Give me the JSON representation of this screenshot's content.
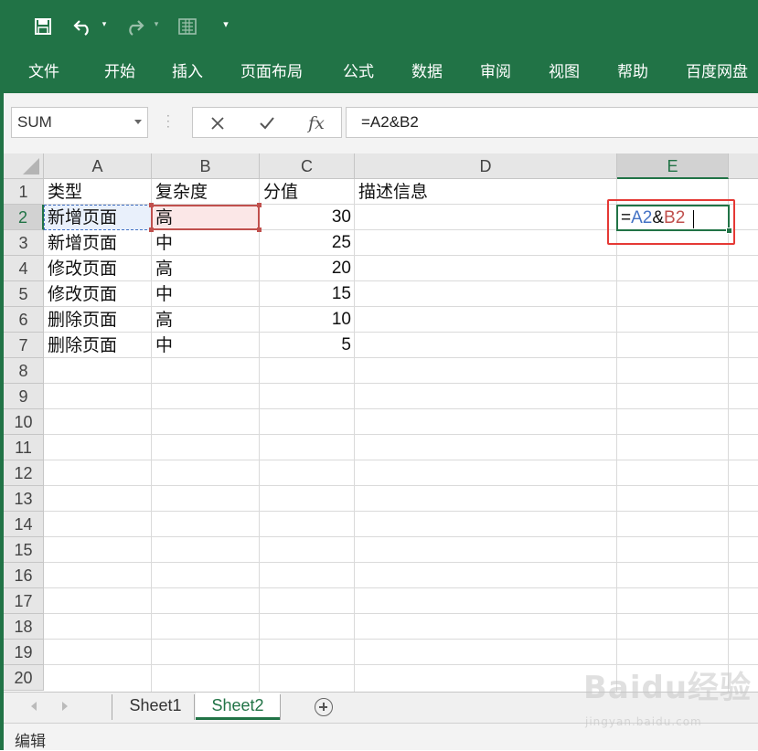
{
  "quick_access": {
    "icons": [
      "save-icon",
      "undo-icon",
      "redo-icon",
      "touch-mode-icon",
      "customize-toolbar-icon"
    ]
  },
  "ribbon": {
    "tabs": [
      "文件",
      "开始",
      "插入",
      "页面布局",
      "公式",
      "数据",
      "审阅",
      "视图",
      "帮助",
      "百度网盘"
    ]
  },
  "formula_bar": {
    "name_box": "SUM",
    "fx_label": "fx",
    "formula": "=A2&B2"
  },
  "grid": {
    "columns": [
      "A",
      "B",
      "C",
      "D",
      "E"
    ],
    "active_column": "E",
    "rows": [
      "1",
      "2",
      "3",
      "4",
      "5",
      "6",
      "7",
      "8",
      "9",
      "10",
      "11",
      "12",
      "13",
      "14",
      "15",
      "16",
      "17",
      "18",
      "19",
      "20"
    ],
    "active_row": "2",
    "headers": {
      "A": "类型",
      "B": "复杂度",
      "C": "分值",
      "D": "描述信息"
    },
    "data": [
      {
        "A": "新增页面",
        "B": "高",
        "C": "30"
      },
      {
        "A": "新增页面",
        "B": "中",
        "C": "25"
      },
      {
        "A": "修改页面",
        "B": "高",
        "C": "20"
      },
      {
        "A": "修改页面",
        "B": "中",
        "C": "15"
      },
      {
        "A": "删除页面",
        "B": "高",
        "C": "10"
      },
      {
        "A": "删除页面",
        "B": "中",
        "C": "5"
      }
    ],
    "active_cell": {
      "eq": "=",
      "ref1": "A2",
      "amp": "&",
      "ref2": "B2",
      "ref1_color": "#4472c4",
      "ref2_color": "#c0504d"
    }
  },
  "sheets": {
    "tabs": [
      "Sheet1",
      "Sheet2"
    ],
    "active": "Sheet2"
  },
  "status": {
    "mode": "编辑"
  },
  "watermark": {
    "logo": "Baidu经验",
    "sub": "jingyan.baidu.com"
  },
  "colors": {
    "excel_green": "#217346",
    "highlight_red": "#e53935"
  }
}
